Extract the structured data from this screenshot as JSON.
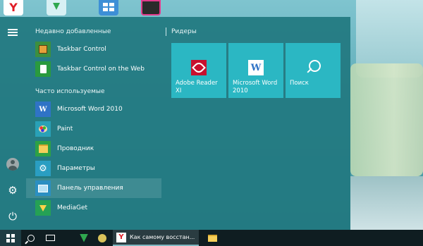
{
  "desktop": {
    "icons": [
      "yandex-browser-icon",
      "download-icon",
      "windows-store-icon",
      "media-app-icon"
    ]
  },
  "start_menu": {
    "recent_header": "Недавно добавленные",
    "recent": [
      {
        "label": "Taskbar Control",
        "icon": "taskbar-control-icon"
      },
      {
        "label": "Taskbar Control on the Web",
        "icon": "web-page-icon"
      }
    ],
    "frequent_header": "Часто используемые",
    "frequent": [
      {
        "label": "Microsoft Word 2010",
        "icon": "word-icon"
      },
      {
        "label": "Paint",
        "icon": "paint-icon"
      },
      {
        "label": "Проводник",
        "icon": "folder-icon"
      },
      {
        "label": "Параметры",
        "icon": "gear-icon"
      },
      {
        "label": "Панель управления",
        "icon": "control-panel-icon",
        "highlighted": true
      },
      {
        "label": "MediaGet",
        "icon": "mediaget-icon"
      }
    ],
    "tiles_group": "Ридеры",
    "tiles": [
      {
        "label": "Adobe Reader XI",
        "icon": "adobe-reader-icon"
      },
      {
        "label": "Microsoft Word 2010",
        "icon": "word-icon"
      },
      {
        "label": "Поиск",
        "icon": "search-icon"
      }
    ],
    "rail": [
      "menu-icon",
      "user-icon",
      "gear-icon",
      "power-icon"
    ],
    "colors": {
      "menu_bg": "#217880",
      "tile_bg": "#2bb7c3",
      "taskbar_bg": "#0f1d21"
    }
  },
  "taskbar": {
    "browser_tab_label": "Как самому восстан...",
    "browser_letter": "Y",
    "icons": [
      "windows-logo-icon",
      "search-icon",
      "task-view-icon",
      "download-icon",
      "app-icon",
      "yandex-browser-icon",
      "folder-icon"
    ]
  }
}
